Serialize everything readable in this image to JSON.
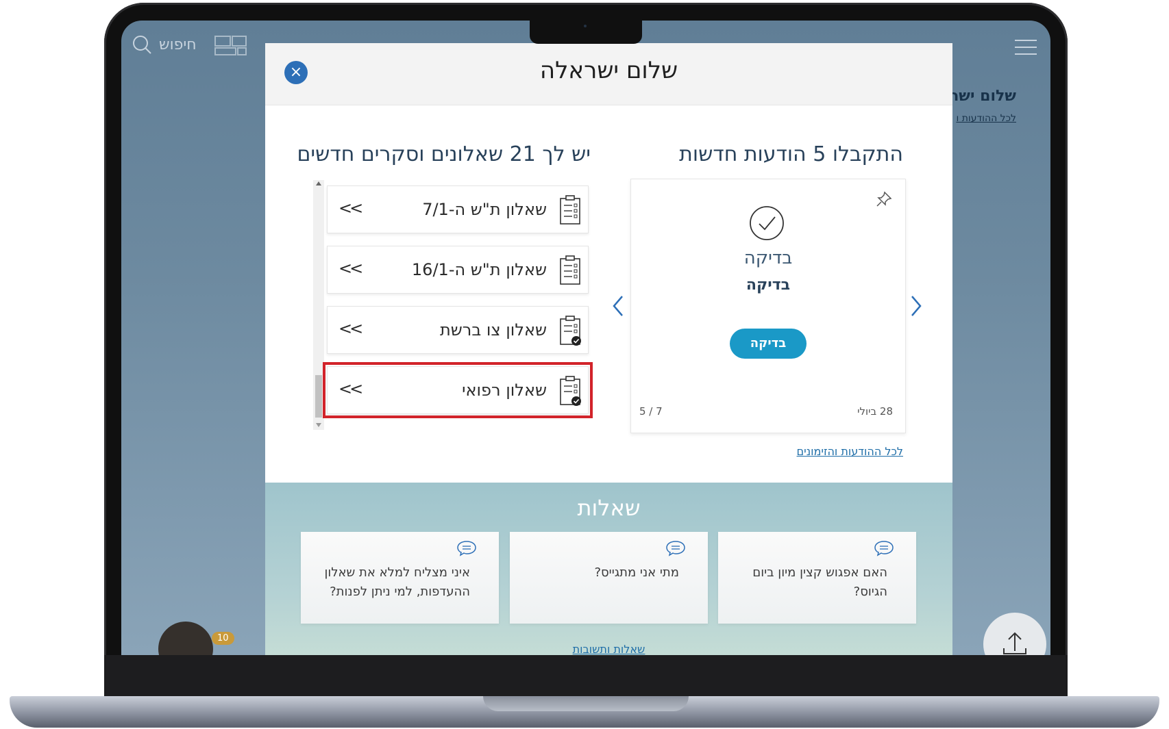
{
  "background_app": {
    "search_label": "חיפוש",
    "side_title": "שלום ישרא",
    "side_link": "לכל ההודעות ו",
    "chat_badge": "10"
  },
  "modal": {
    "title": "שלום ישראלה",
    "close_symbol": "×",
    "messages": {
      "title": "התקבלו 5 הודעות חדשות",
      "card": {
        "subtitle": "בדיקה",
        "heading": "בדיקה",
        "button": "בדיקה",
        "date": "28 ביולי",
        "counter": "5 / 7"
      },
      "all_link": "לכל ההודעות והזימונים"
    },
    "surveys": {
      "title": "יש לך 21 שאלונים וסקרים חדשים",
      "items": [
        {
          "label": "שאלון ת\"ש ה-7/1",
          "chevron": "<<",
          "done": false,
          "selected": false
        },
        {
          "label": "שאלון ת\"ש ה-16/1",
          "chevron": "<<",
          "done": false,
          "selected": false
        },
        {
          "label": "שאלון צו ברשת",
          "chevron": "<<",
          "done": true,
          "selected": false
        },
        {
          "label": "שאלון רפואי",
          "chevron": "<<",
          "done": true,
          "selected": true
        }
      ]
    },
    "faq": {
      "title": "שאלות",
      "questions": [
        "האם אפגוש קצין מיון ביום הגיוס?",
        "מתי אני מתגייס?",
        "איני מצליח למלא את שאלון ההעדפות, למי ניתן לפנות?"
      ],
      "link": "שאלות ותשובות"
    }
  },
  "colors": {
    "accent": "#1a99c7",
    "close": "#2d6fb7",
    "highlight": "#d2232a",
    "link": "#1f6ea8"
  }
}
